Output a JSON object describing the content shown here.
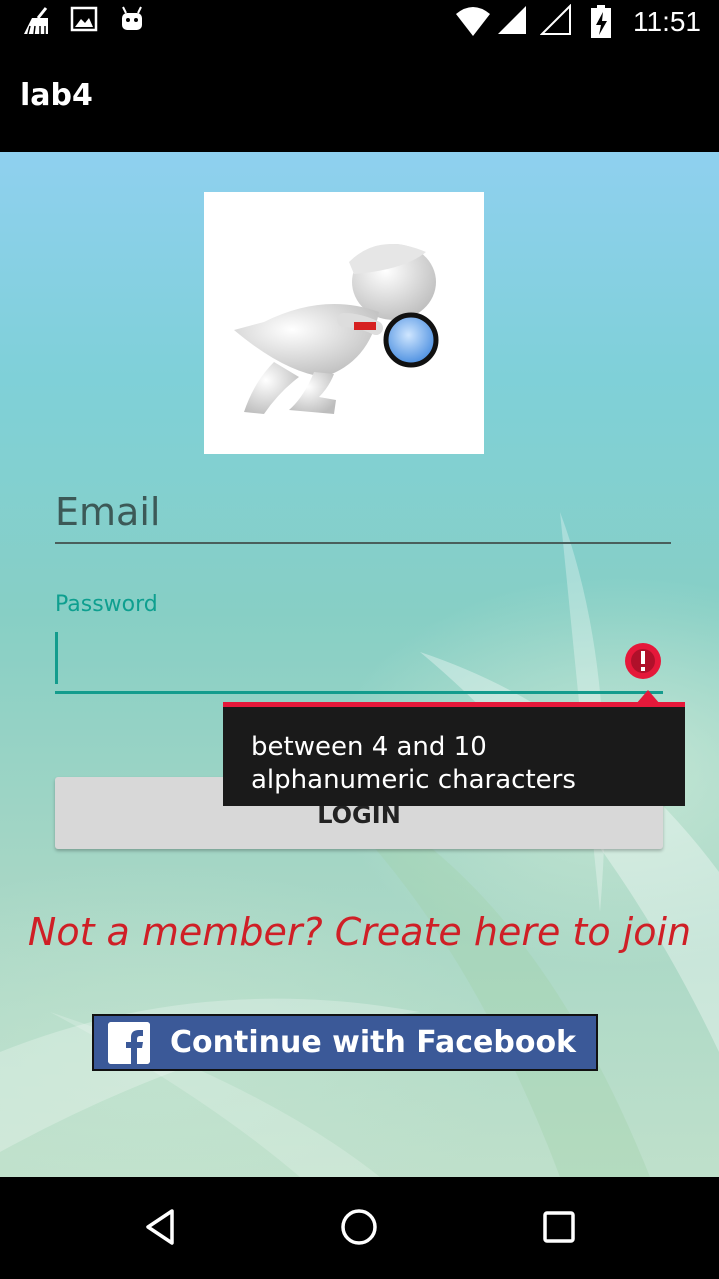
{
  "status_bar": {
    "time": "11:51",
    "icons": [
      "cleaner-icon",
      "image-icon",
      "android-icon",
      "wifi-icon",
      "signal-icon",
      "signal-empty-icon",
      "battery-charging-icon"
    ]
  },
  "app_bar": {
    "title": "lab4"
  },
  "login_form": {
    "email_placeholder": "Email",
    "password_label": "Password",
    "password_error": "between 4 and 10 alphanumeric characters",
    "login_label": "LOGIN",
    "signup_text": "Not a member? Create here to join",
    "facebook_label": "Continue with Facebook"
  },
  "colors": {
    "accent": "#139c8d",
    "error": "#e5183a",
    "signup_text": "#cf1f26",
    "facebook": "#3b5998"
  },
  "nav_bar": {
    "icons": [
      "back-icon",
      "home-icon",
      "recents-icon"
    ]
  }
}
